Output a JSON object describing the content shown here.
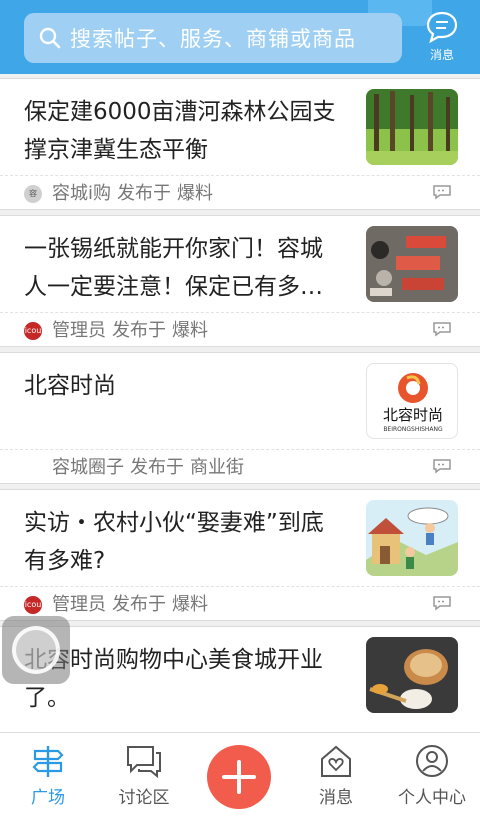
{
  "header": {
    "search_placeholder": "搜索帖子、服务、商铺或商品",
    "message_label": "消息"
  },
  "posts": [
    {
      "title": "保定建6000亩漕河森林公园支撑京津冀生态平衡",
      "author": "容城i购",
      "posted_in": "发布于",
      "category": "爆料",
      "avatar": "容"
    },
    {
      "title": "一张锡纸就能开你家门！容城人一定要注意！保定已有多…",
      "author": "管理员",
      "posted_in": "发布于",
      "category": "爆料",
      "avatar": "icou"
    },
    {
      "title": "北容时尚",
      "author": "容城圈子",
      "posted_in": "发布于",
      "category": "商业街",
      "avatar": "",
      "logo_text": "北容时尚",
      "logo_sub": "BEIRONGSHISHANG"
    },
    {
      "title": "实访・农村小伙“娶妻难”到底有多难?",
      "author": "管理员",
      "posted_in": "发布于",
      "category": "爆料",
      "avatar": "icou"
    },
    {
      "title": "北容时尚购物中心美食城开业了。",
      "author": "",
      "posted_in": "",
      "category": "",
      "avatar": ""
    }
  ],
  "tabbar": {
    "tabs": [
      {
        "label": "广场",
        "icon": "signpost-icon",
        "active": true
      },
      {
        "label": "讨论区",
        "icon": "chat-bubbles-icon",
        "active": false
      },
      {
        "label": "",
        "icon": "plus-icon",
        "active": false
      },
      {
        "label": "消息",
        "icon": "home-heart-icon",
        "active": false
      },
      {
        "label": "个人中心",
        "icon": "person-icon",
        "active": false
      }
    ]
  },
  "colors": {
    "header_bg": "#3fa6e8",
    "accent_blue": "#2b9ae4",
    "fab_red": "#f25c4c"
  }
}
